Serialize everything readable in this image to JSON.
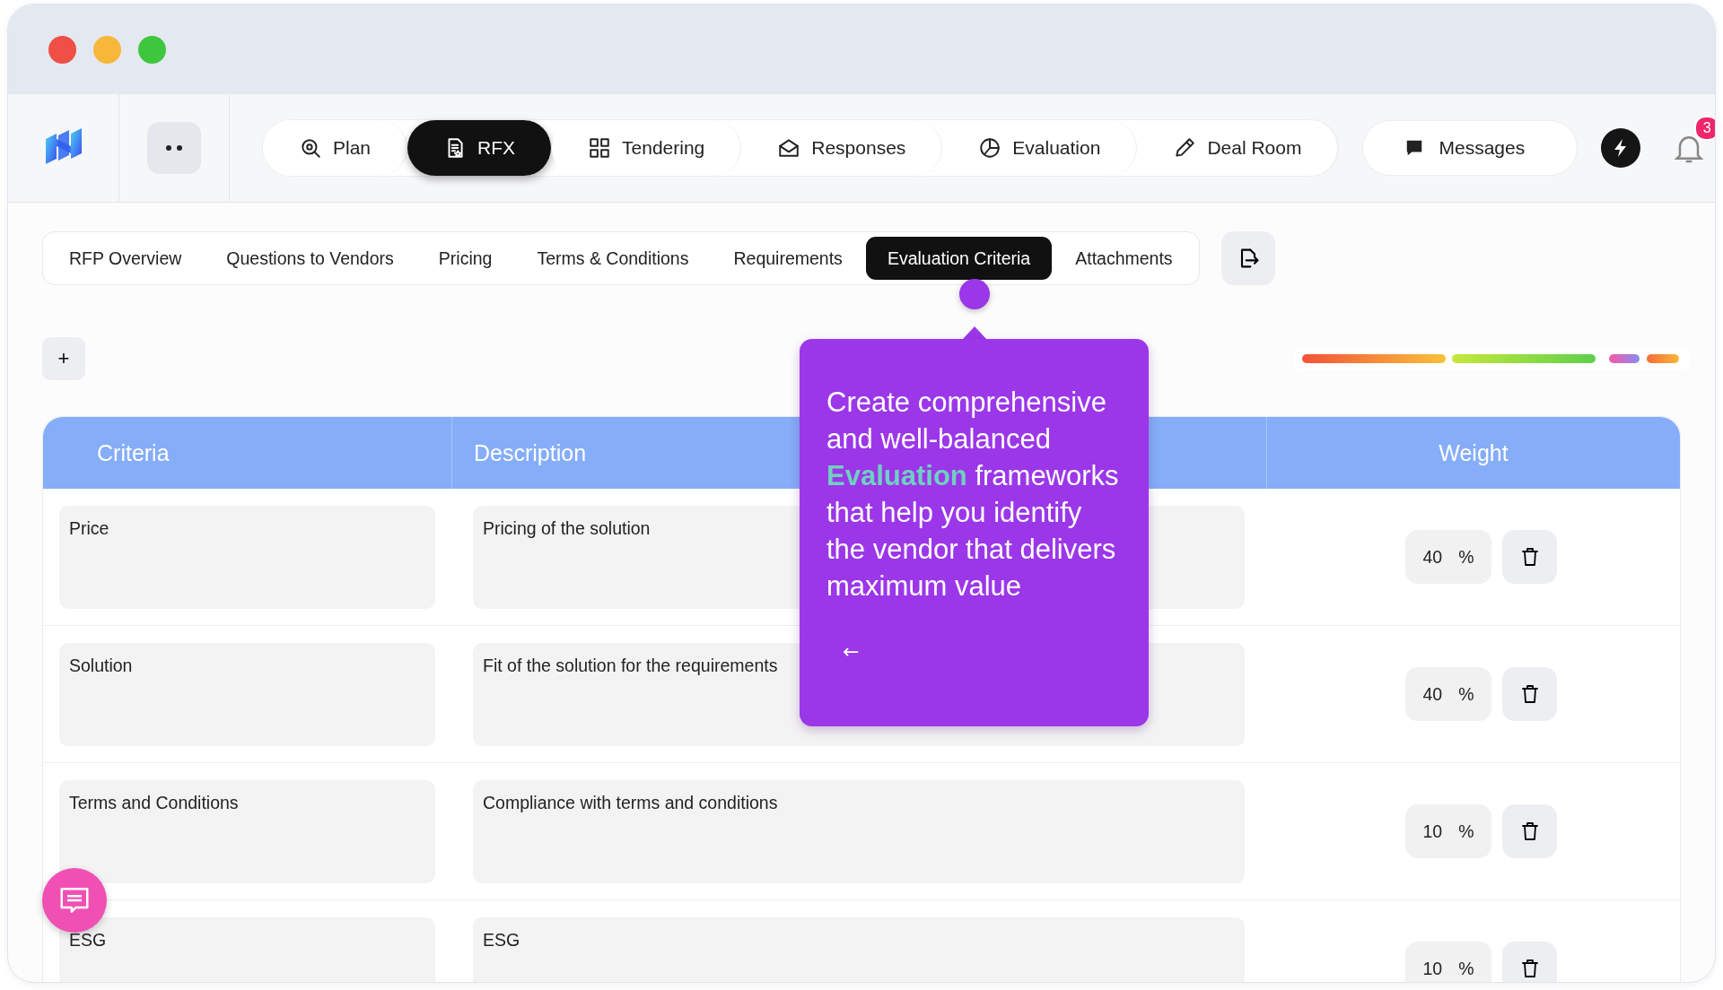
{
  "window": {
    "controls": [
      {
        "color": "#ef4f45"
      },
      {
        "color": "#f6b73a"
      },
      {
        "color": "#3ec63f"
      }
    ]
  },
  "nav": {
    "tabs": [
      {
        "label": "Plan",
        "selected": false
      },
      {
        "label": "RFX",
        "selected": true
      },
      {
        "label": "Tendering",
        "selected": false
      },
      {
        "label": "Responses",
        "selected": false
      },
      {
        "label": "Evaluation",
        "selected": false
      },
      {
        "label": "Deal Room",
        "selected": false
      }
    ],
    "messages": "Messages",
    "notification_count": "3"
  },
  "section_tabs": [
    {
      "label": "RFP Overview",
      "selected": false
    },
    {
      "label": "Questions to Vendors",
      "selected": false
    },
    {
      "label": "Pricing",
      "selected": false
    },
    {
      "label": "Terms & Conditions",
      "selected": false
    },
    {
      "label": "Requirements",
      "selected": false
    },
    {
      "label": "Evaluation Criteria",
      "selected": true
    },
    {
      "label": "Attachments",
      "selected": false
    }
  ],
  "add_button": "+",
  "tooltip": {
    "text": "Create comprehensive and well-balanced **Evaluation** frameworks that help you identify the vendor that delivers maximum value",
    "back": "←"
  },
  "table": {
    "columns": [
      "Criteria",
      "Description",
      "Weight"
    ],
    "rows": [
      {
        "criteria": "Price",
        "description": "Pricing of the solution",
        "weight": "40",
        "unit": "%"
      },
      {
        "criteria": "Solution",
        "description": "Fit of the solution for the requirements",
        "weight": "40",
        "unit": "%"
      },
      {
        "criteria": "Terms and Conditions",
        "description": "Compliance with terms and conditions",
        "weight": "10",
        "unit": "%"
      },
      {
        "criteria": "ESG",
        "description": "ESG",
        "weight": "10",
        "unit": "%"
      }
    ]
  }
}
